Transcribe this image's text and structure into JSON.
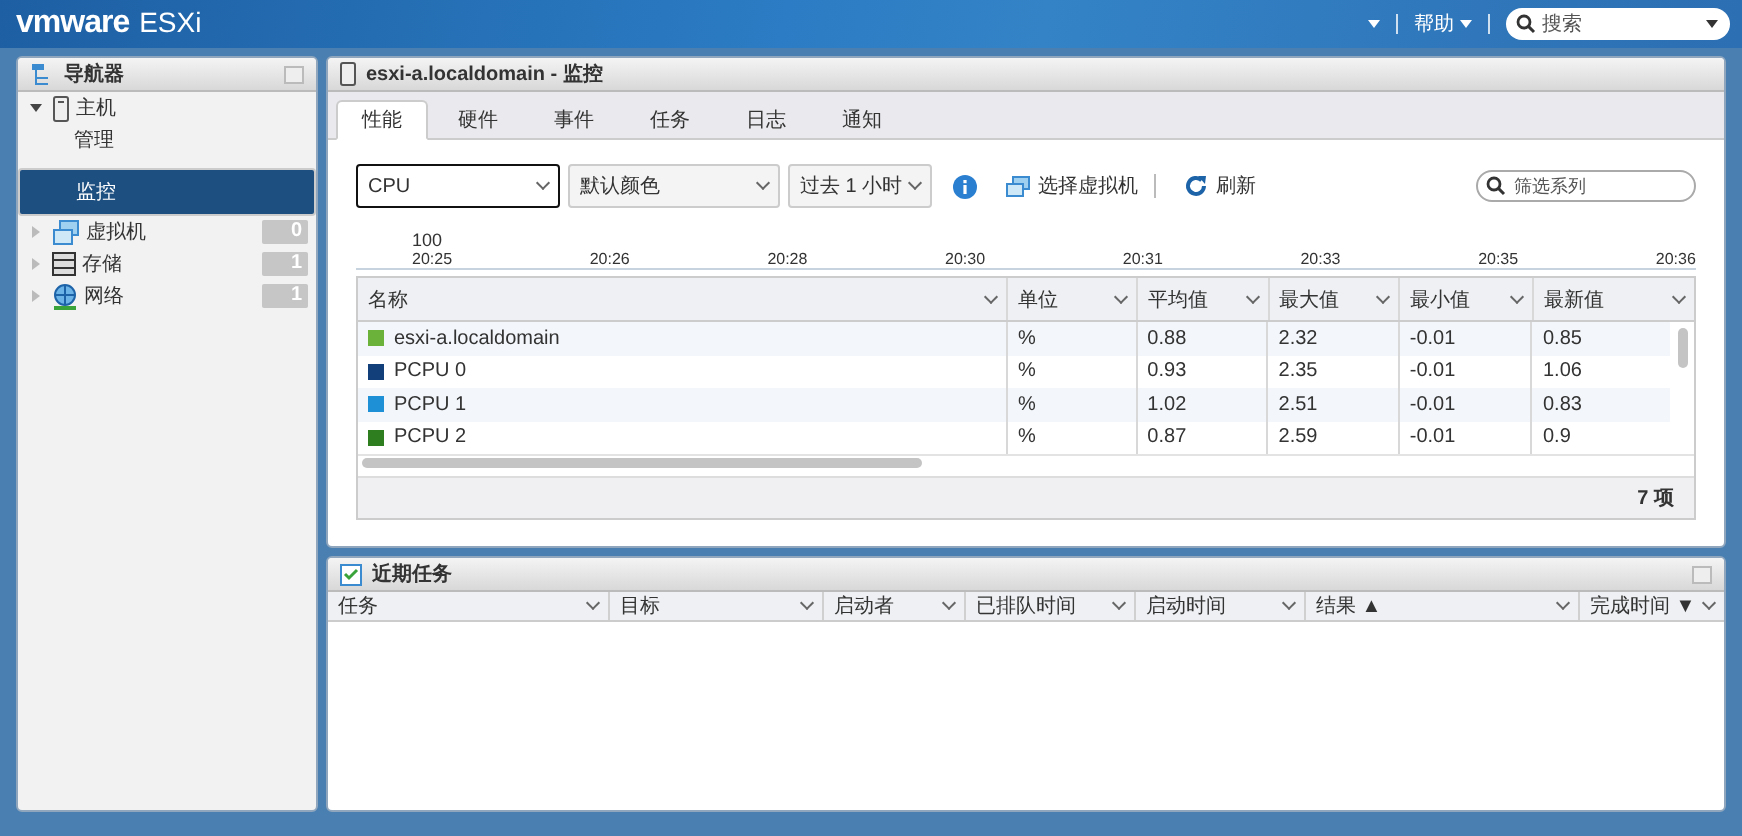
{
  "header": {
    "brand": "vmware",
    "product": "ESXi",
    "help": "帮助",
    "search_placeholder": "搜索"
  },
  "navigator": {
    "title": "导航器",
    "items": [
      {
        "label": "主机",
        "kind": "host",
        "expanded": true,
        "selected": false,
        "children": [
          {
            "label": "管理",
            "selected": false
          },
          {
            "label": "监控",
            "selected": true
          }
        ]
      },
      {
        "label": "虚拟机",
        "kind": "vm",
        "expanded": false,
        "selected": false,
        "count": "0"
      },
      {
        "label": "存储",
        "kind": "storage",
        "expanded": false,
        "selected": false,
        "count": "1"
      },
      {
        "label": "网络",
        "kind": "network",
        "expanded": false,
        "selected": false,
        "count": "1"
      }
    ]
  },
  "monitor": {
    "title": "esxi-a.localdomain - 监控",
    "tabs": [
      {
        "label": "性能",
        "selected": true
      },
      {
        "label": "硬件",
        "selected": false
      },
      {
        "label": "事件",
        "selected": false
      },
      {
        "label": "任务",
        "selected": false
      },
      {
        "label": "日志",
        "selected": false
      },
      {
        "label": "通知",
        "selected": false
      }
    ],
    "selects": [
      {
        "value": "CPU",
        "focused": true
      },
      {
        "value": "默认颜色",
        "focused": false
      },
      {
        "value": "过去 1 小时",
        "focused": false
      }
    ],
    "select_vm": "选择虚拟机",
    "refresh": "刷新",
    "filter_placeholder": "筛选系列",
    "chart_axis": {
      "top_label": "100",
      "times": [
        "20:25",
        "20:26",
        "20:28",
        "20:30",
        "20:31",
        "20:33",
        "20:35",
        "20:36"
      ]
    },
    "columns": [
      "名称",
      "单位",
      "平均值",
      "最大值",
      "最小值",
      "最新值"
    ],
    "rows": [
      {
        "name": "esxi-a.localdomain",
        "color": "#6ab23a",
        "unit": "%",
        "avg": "0.88",
        "max": "2.32",
        "min": "-0.01",
        "latest": "0.85"
      },
      {
        "name": "PCPU 0",
        "color": "#123f7a",
        "unit": "%",
        "avg": "0.93",
        "max": "2.35",
        "min": "-0.01",
        "latest": "1.06"
      },
      {
        "name": "PCPU 1",
        "color": "#1e90d6",
        "unit": "%",
        "avg": "1.02",
        "max": "2.51",
        "min": "-0.01",
        "latest": "0.83"
      },
      {
        "name": "PCPU 2",
        "color": "#2e7d1e",
        "unit": "%",
        "avg": "0.87",
        "max": "2.59",
        "min": "-0.01",
        "latest": "0.9"
      }
    ],
    "item_count": "7 项"
  },
  "tasks": {
    "title": "近期任务",
    "columns": [
      "任务",
      "目标",
      "启动者",
      "已排队时间",
      "启动时间",
      "结果 ▲",
      "完成时间 ▼"
    ]
  }
}
